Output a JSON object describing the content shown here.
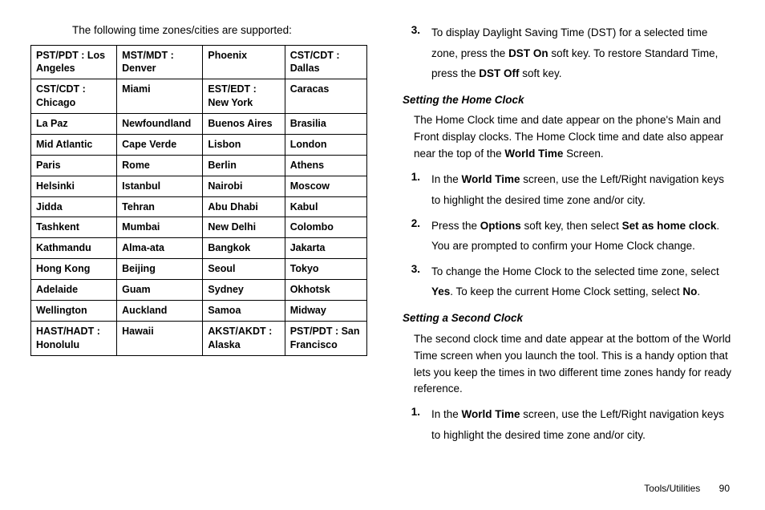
{
  "left": {
    "intro": "The following time zones/cities are supported:",
    "rows": [
      [
        "PST/PDT : Los Angeles",
        "MST/MDT : Denver",
        "Phoenix",
        "CST/CDT : Dallas"
      ],
      [
        "CST/CDT : Chicago",
        "Miami",
        "EST/EDT : New York",
        "Caracas"
      ],
      [
        "La Paz",
        "Newfoundland",
        "Buenos Aires",
        "Brasilia"
      ],
      [
        "Mid Atlantic",
        "Cape Verde",
        "Lisbon",
        "London"
      ],
      [
        "Paris",
        "Rome",
        "Berlin",
        "Athens"
      ],
      [
        "Helsinki",
        "Istanbul",
        "Nairobi",
        "Moscow"
      ],
      [
        "Jidda",
        "Tehran",
        "Abu Dhabi",
        "Kabul"
      ],
      [
        "Tashkent",
        "Mumbai",
        "New Delhi",
        "Colombo"
      ],
      [
        "Kathmandu",
        "Alma-ata",
        "Bangkok",
        "Jakarta"
      ],
      [
        "Hong Kong",
        "Beijing",
        "Seoul",
        "Tokyo"
      ],
      [
        "Adelaide",
        "Guam",
        "Sydney",
        "Okhotsk"
      ],
      [
        "Wellington",
        "Auckland",
        "Samoa",
        "Midway"
      ],
      [
        "HAST/HADT : Honolulu",
        "Hawaii",
        "AKST/AKDT : Alaska",
        "PST/PDT : San Francisco"
      ]
    ]
  },
  "right": {
    "step3": {
      "num": "3.",
      "t1": "To display Daylight Saving Time (DST) for a selected time zone, press the ",
      "b1": "DST On",
      "t2": " soft key. To restore Standard Time, press the ",
      "b2": "DST Off",
      "t3": " soft key."
    },
    "secA": {
      "title": "Setting the Home Clock",
      "p1a": "The Home Clock time and date appear on the phone's Main and Front display clocks. The Home Clock time and date also appear near the top of the ",
      "p1b": "World Time",
      "p1c": " Screen.",
      "s1": {
        "num": "1.",
        "a": "In the ",
        "b": "World Time",
        "c": " screen, use the Left/Right navigation keys to highlight the desired time zone and/or city."
      },
      "s2": {
        "num": "2.",
        "a": "Press the ",
        "b": "Options",
        "c": " soft key, then select ",
        "d": "Set as home clock",
        "e": ". You are prompted to confirm your Home Clock change."
      },
      "s3": {
        "num": "3.",
        "a": "To change the Home Clock to the selected time zone, select ",
        "b": "Yes",
        "c": ". To keep the current Home Clock setting, select ",
        "d": "No",
        "e": "."
      }
    },
    "secB": {
      "title": "Setting a Second Clock",
      "p": "The second clock time and date appear at the bottom of the World Time screen when you launch the tool. This is a handy option that lets you keep the times in two different time zones handy for ready reference.",
      "s1": {
        "num": "1.",
        "a": "In the ",
        "b": "World Time",
        "c": " screen, use the Left/Right navigation keys to highlight the desired time zone and/or city."
      }
    }
  },
  "footer": {
    "section": "Tools/Utilities",
    "page": "90"
  }
}
